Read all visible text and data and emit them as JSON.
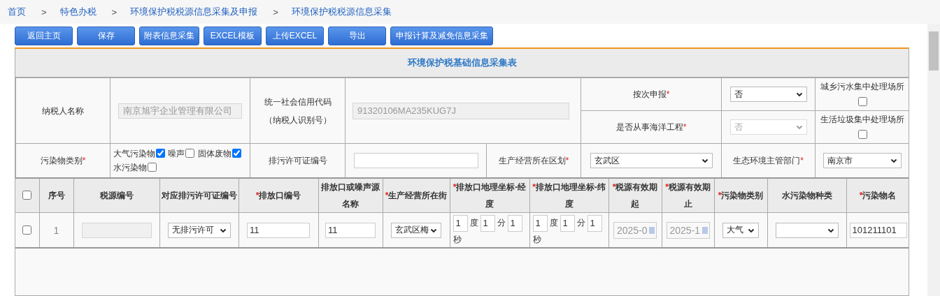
{
  "breadcrumb": [
    {
      "label": "首页"
    },
    {
      "separator": ">",
      "label": "特色办税"
    },
    {
      "separator": ">",
      "label": "环境保护税税源信息采集及申报"
    },
    {
      "separator": ">",
      "label": "环境保护税税源信息采集"
    }
  ],
  "toolbar": {
    "buttons": [
      "返回主页",
      "保存",
      "附表信息采集",
      "EXCEL模板",
      "上传EXCEL",
      "导出",
      "申报计算及减免信息采集"
    ]
  },
  "form": {
    "title": "环境保护税基础信息采集表",
    "taxpayer_name": {
      "label": "纳税人名称",
      "value": "南京旭宇企业管理有限公司",
      "disabled": true
    },
    "credit_code": {
      "label_lines": [
        "统一社会信用代码",
        "（纳税人识别号）"
      ],
      "value": "91320106MA235KUG7J",
      "disabled": true
    },
    "per_declaration": {
      "label": "按次申报",
      "required_mark": "*",
      "value": "否",
      "disabled": false
    },
    "marine_engineering": {
      "label": "是否从事海洋工程",
      "required_mark": "*",
      "value": "否",
      "disabled": true
    },
    "sewage_plant": {
      "label": "城乡污水集中处理场所",
      "checked": false
    },
    "garbage_plant": {
      "label": "生活垃圾集中处理场所",
      "checked": false
    },
    "pollutant_category": {
      "label": "污染物类别",
      "required_mark": "*",
      "options": [
        {
          "label": "大气污染物",
          "checked": true
        },
        {
          "label": "噪声",
          "checked": false
        },
        {
          "label": "固体废物",
          "checked": true
        },
        {
          "label": "水污染物",
          "checked": false
        }
      ]
    },
    "permit_number": {
      "label": "排污许可证编号"
    },
    "district": {
      "label": "生产经营所在区划",
      "required_mark": "*",
      "value": "玄武区",
      "disabled": false
    },
    "eco_department": {
      "label": "生态环境主管部门",
      "required_mark": "*",
      "value": "南京市",
      "disabled": false
    }
  },
  "grid": {
    "header_checked": false,
    "columns": [
      {
        "label": "序号"
      },
      {
        "label": "税源编号"
      },
      {
        "label": "对应排污许可证编号"
      },
      {
        "label": "排放口编号",
        "required_mark": "*"
      },
      {
        "label": "排放口或噪声源名称"
      },
      {
        "label": "生产经营所在街",
        "required_mark": "*"
      },
      {
        "label": "排放口地理坐标-经度",
        "required_mark": "*"
      },
      {
        "label": "排放口地理坐标-纬度",
        "required_mark": "*"
      },
      {
        "label": "税源有效期起",
        "required_mark": "*"
      },
      {
        "label": "税源有效期止",
        "required_mark": "*"
      },
      {
        "label": "污染物类别",
        "required_mark": "*"
      },
      {
        "label": "水污染物种类"
      },
      {
        "label": "污染物名",
        "required_mark": "*"
      }
    ],
    "rows": [
      {
        "checked": false,
        "cells": [
          {
            "kind": "text",
            "value": "1"
          },
          {
            "kind": "input",
            "disabled": true
          },
          {
            "kind": "select",
            "value": "无排污许可"
          },
          {
            "kind": "input",
            "value": "11",
            "disabled": false
          },
          {
            "kind": "input",
            "value": "11",
            "disabled": false
          },
          {
            "kind": "select",
            "value": "玄武区梅"
          },
          {
            "kind": "coord",
            "degrees": "1",
            "degree_unit": "度",
            "minutes": "1",
            "minute_unit": "分",
            "seconds": "1",
            "second_unit": "秒"
          },
          {
            "kind": "coord",
            "degrees": "1",
            "degree_unit": "度",
            "minutes": "1",
            "minute_unit": "分",
            "seconds": "1",
            "second_unit": "秒"
          },
          {
            "kind": "date",
            "value": "2025-0"
          },
          {
            "kind": "date",
            "value": "2025-1"
          },
          {
            "kind": "select",
            "value": "大气"
          },
          {
            "kind": "select"
          },
          {
            "kind": "input",
            "value": "101211101",
            "disabled": false
          }
        ]
      }
    ]
  }
}
